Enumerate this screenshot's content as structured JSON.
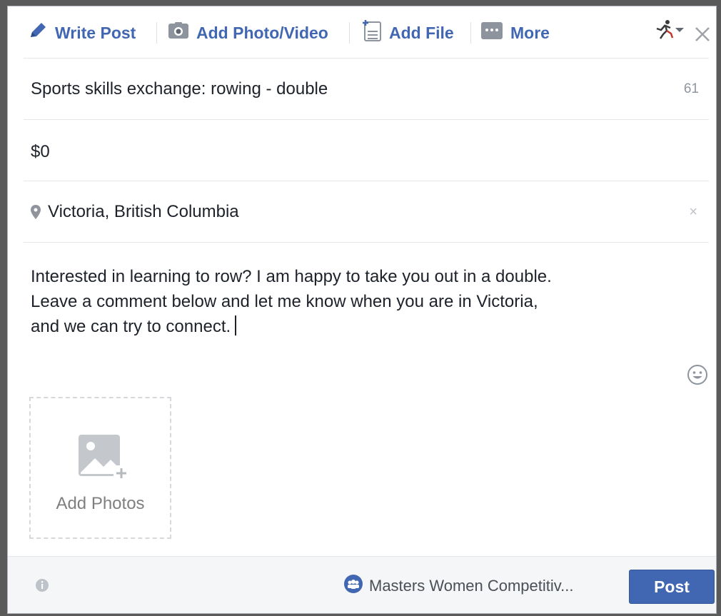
{
  "toolbar": {
    "write_post": "Write Post",
    "add_photo_video": "Add Photo/Video",
    "add_file": "Add File",
    "more": "More"
  },
  "listing": {
    "title": "Sports skills exchange: rowing - double",
    "title_counter": "61",
    "price": "$0",
    "location": "Victoria, British Columbia",
    "location_clear": "×",
    "description_lines": [
      "Interested in learning to row? I am happy to take you out in a double.",
      "Leave a comment below and let me know when you are in Victoria,",
      "and we can try to connect."
    ]
  },
  "add_photos": {
    "label": "Add Photos"
  },
  "footer": {
    "audience": "Masters Women Competitiv...",
    "post_label": "Post"
  },
  "colors": {
    "accent": "#4267b2",
    "muted": "#90949c"
  },
  "icons": [
    "pencil-icon",
    "camera-icon",
    "file-icon",
    "more-icon",
    "runner-icon",
    "dropdown-arrow-icon",
    "close-icon",
    "location-pin-icon",
    "emoji-icon",
    "add-photo-icon",
    "info-icon",
    "group-icon"
  ]
}
